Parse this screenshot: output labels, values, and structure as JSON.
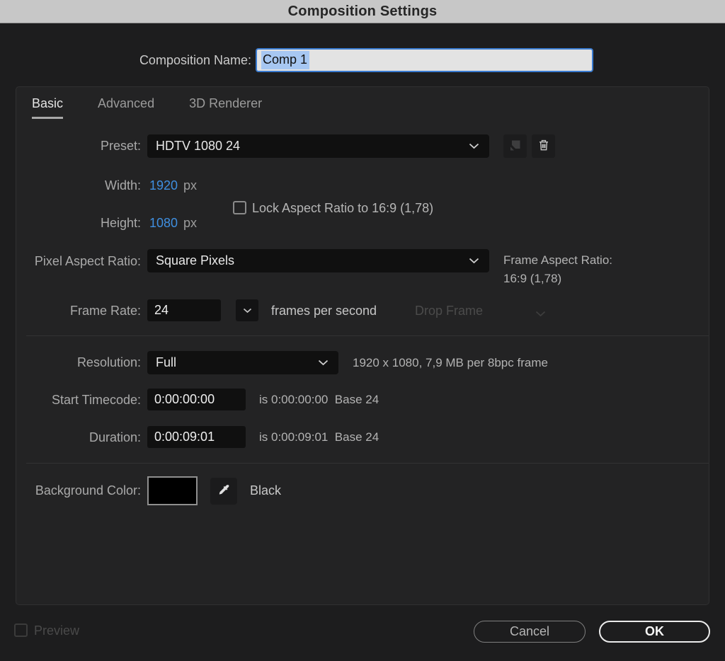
{
  "title": "Composition Settings",
  "composition_name": {
    "label": "Composition Name:",
    "value": "Comp 1"
  },
  "tabs": [
    {
      "label": "Basic",
      "active": true
    },
    {
      "label": "Advanced",
      "active": false
    },
    {
      "label": "3D Renderer",
      "active": false
    }
  ],
  "basic": {
    "preset": {
      "label": "Preset:",
      "value": "HDTV 1080 24"
    },
    "width": {
      "label": "Width:",
      "value": "1920",
      "unit": "px"
    },
    "height": {
      "label": "Height:",
      "value": "1080",
      "unit": "px"
    },
    "lock_aspect": {
      "label": "Lock Aspect Ratio to 16:9 (1,78)",
      "checked": false
    },
    "pixel_aspect_ratio": {
      "label": "Pixel Aspect Ratio:",
      "value": "Square Pixels"
    },
    "frame_aspect_ratio": {
      "label": "Frame Aspect Ratio:",
      "value": "16:9 (1,78)"
    },
    "frame_rate": {
      "label": "Frame Rate:",
      "value": "24",
      "suffix": "frames per second",
      "drop_frame": "Drop Frame",
      "drop_frame_enabled": false
    },
    "resolution": {
      "label": "Resolution:",
      "value": "Full",
      "info": "1920 x 1080, 7,9 MB per 8bpc frame"
    },
    "start_timecode": {
      "label": "Start Timecode:",
      "value": "0:00:00:00",
      "info": "is 0:00:00:00  Base 24"
    },
    "duration": {
      "label": "Duration:",
      "value": "0:00:09:01",
      "info": "is 0:00:09:01  Base 24"
    },
    "background_color": {
      "label": "Background Color:",
      "color_name": "Black",
      "swatch_hex": "#000000"
    }
  },
  "footer": {
    "preview_label": "Preview",
    "preview_checked": false,
    "cancel_label": "Cancel",
    "ok_label": "OK"
  },
  "icons": {
    "chevron_down": "chevron-down",
    "save_preset": "folded-square",
    "delete_preset": "trash-can",
    "eyedropper": "eyedropper"
  },
  "colors": {
    "value_blue": "#3f8fe0",
    "name_input_border": "#3a7bd0",
    "name_selection": "#a7c7f2",
    "titlebar_bg": "#c7c7c7",
    "panel_bg": "#232324"
  }
}
